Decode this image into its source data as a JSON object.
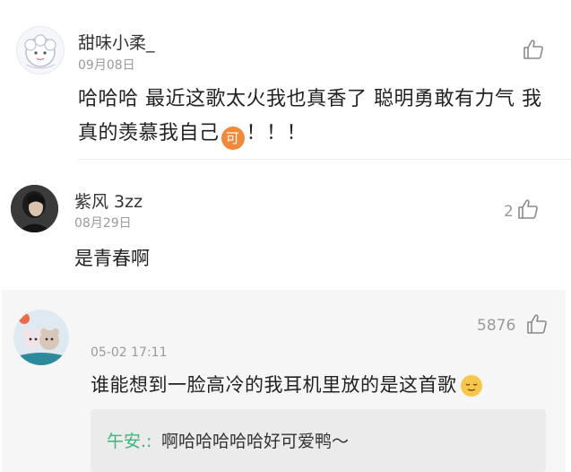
{
  "comments": [
    {
      "username": "甜味小柔_",
      "date": "09月08日",
      "text_before_emoji": "哈哈哈 最近这歌太火我也真香了 聪明勇敢有力气 我真的羡慕我自己",
      "emoji_label": "可",
      "text_after_emoji": "！！！",
      "avatar_icon": "cartoon-sheep-icon",
      "like_icon": "thumbs-up-icon"
    },
    {
      "username": "紫风 3zz",
      "date": "08月29日",
      "text": "是青春啊",
      "like_count": "2",
      "avatar_icon": "user-photo-icon",
      "like_icon": "thumbs-up-icon"
    },
    {
      "date": "05-02 17:11",
      "text": "谁能想到一脸高冷的我耳机里放的是这首歌",
      "emoji": "relieved-face-emoji",
      "like_count": "5876",
      "avatar_icon": "plush-toy-photo-icon",
      "like_icon": "thumbs-up-icon",
      "reply": {
        "author": "午安.:",
        "text": "啊哈哈哈哈哈好可爱鸭～"
      }
    }
  ],
  "colors": {
    "reply_author": "#37b87a",
    "highlight_bg": "#f6f6f6",
    "reply_bg": "#ebebeb",
    "emoji_orange": "#f08a3a"
  }
}
